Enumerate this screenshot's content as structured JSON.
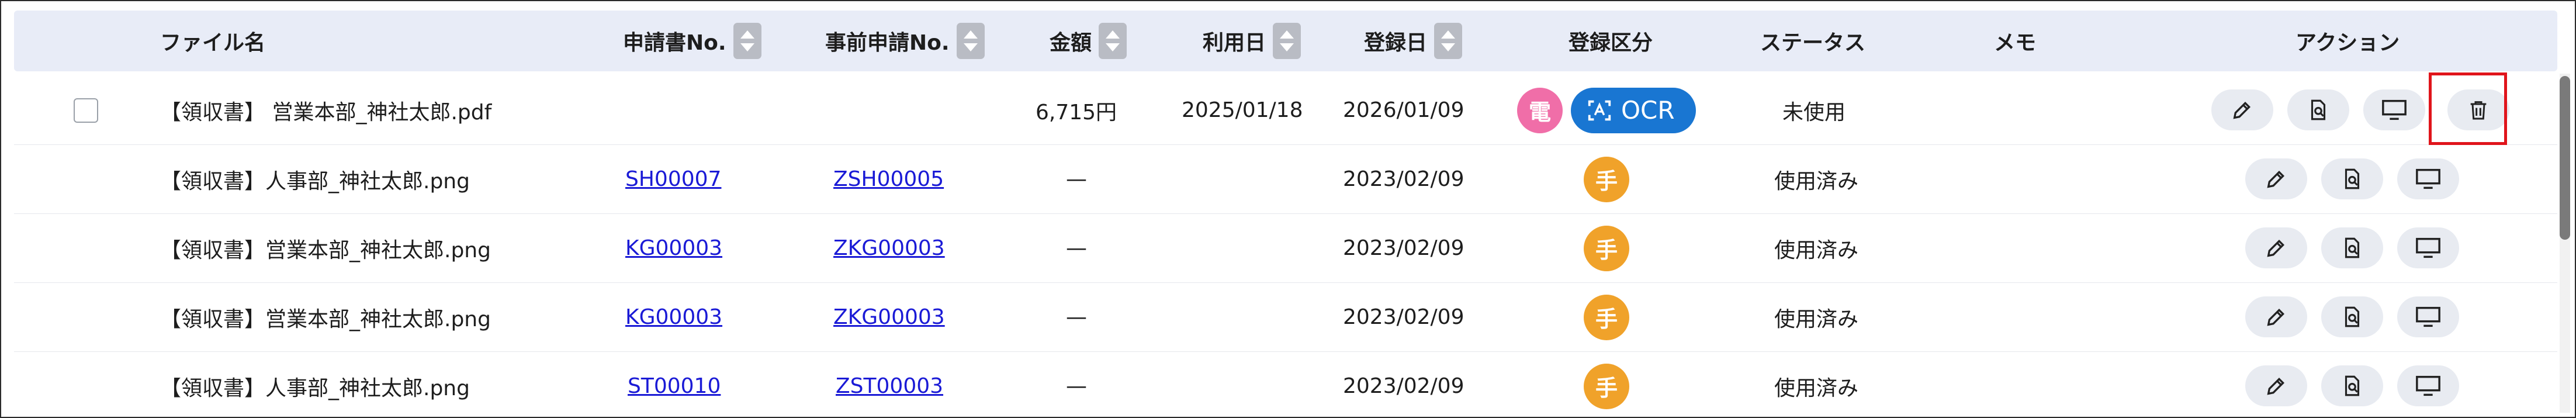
{
  "headers": {
    "file_name": "ファイル名",
    "application_no": "申請書No.",
    "pre_application_no": "事前申請No.",
    "amount": "金額",
    "use_date": "利用日",
    "register_date": "登録日",
    "register_type": "登録区分",
    "status": "ステータス",
    "memo": "メモ",
    "action": "アクション"
  },
  "rows": [
    {
      "file_name": "【領収書】 営業本部_神社太郎.pdf",
      "application_no": "",
      "pre_application_no": "",
      "amount": "6,715円",
      "use_date": "2025/01/18",
      "register_date": "2026/01/09",
      "badge": "電",
      "ocr_label": "OCR",
      "status": "未使用",
      "has_delete": true
    },
    {
      "file_name": "【領収書】人事部_神社太郎.png",
      "application_no": "SH00007",
      "pre_application_no": "ZSH00005",
      "amount": "—",
      "use_date": "",
      "register_date": "2023/02/09",
      "badge": "手",
      "status": "使用済み",
      "has_delete": false
    },
    {
      "file_name": "【領収書】営業本部_神社太郎.png",
      "application_no": "KG00003",
      "pre_application_no": "ZKG00003",
      "amount": "—",
      "use_date": "",
      "register_date": "2023/02/09",
      "badge": "手",
      "status": "使用済み",
      "has_delete": false
    },
    {
      "file_name": "【領収書】営業本部_神社太郎.png",
      "application_no": "KG00003",
      "pre_application_no": "ZKG00003",
      "amount": "—",
      "use_date": "",
      "register_date": "2023/02/09",
      "badge": "手",
      "status": "使用済み",
      "has_delete": false
    },
    {
      "file_name": "【領収書】人事部_神社太郎.png",
      "application_no": "ST00010",
      "pre_application_no": "ZST00003",
      "amount": "—",
      "use_date": "",
      "register_date": "2023/02/09",
      "badge": "手",
      "status": "使用済み",
      "has_delete": false
    }
  ],
  "icons": {
    "edit": "pencil-icon",
    "preview": "document-search-icon",
    "display": "monitor-icon",
    "delete": "trash-icon",
    "ocr": "scan-text-icon"
  },
  "colors": {
    "header_bg": "#e8ecf7",
    "link": "#1a1ad6",
    "ocr_pill": "#1976d2",
    "badge_denshi": "#f06ea8",
    "badge_te": "#f0a22a",
    "highlight": "#e0141b"
  }
}
